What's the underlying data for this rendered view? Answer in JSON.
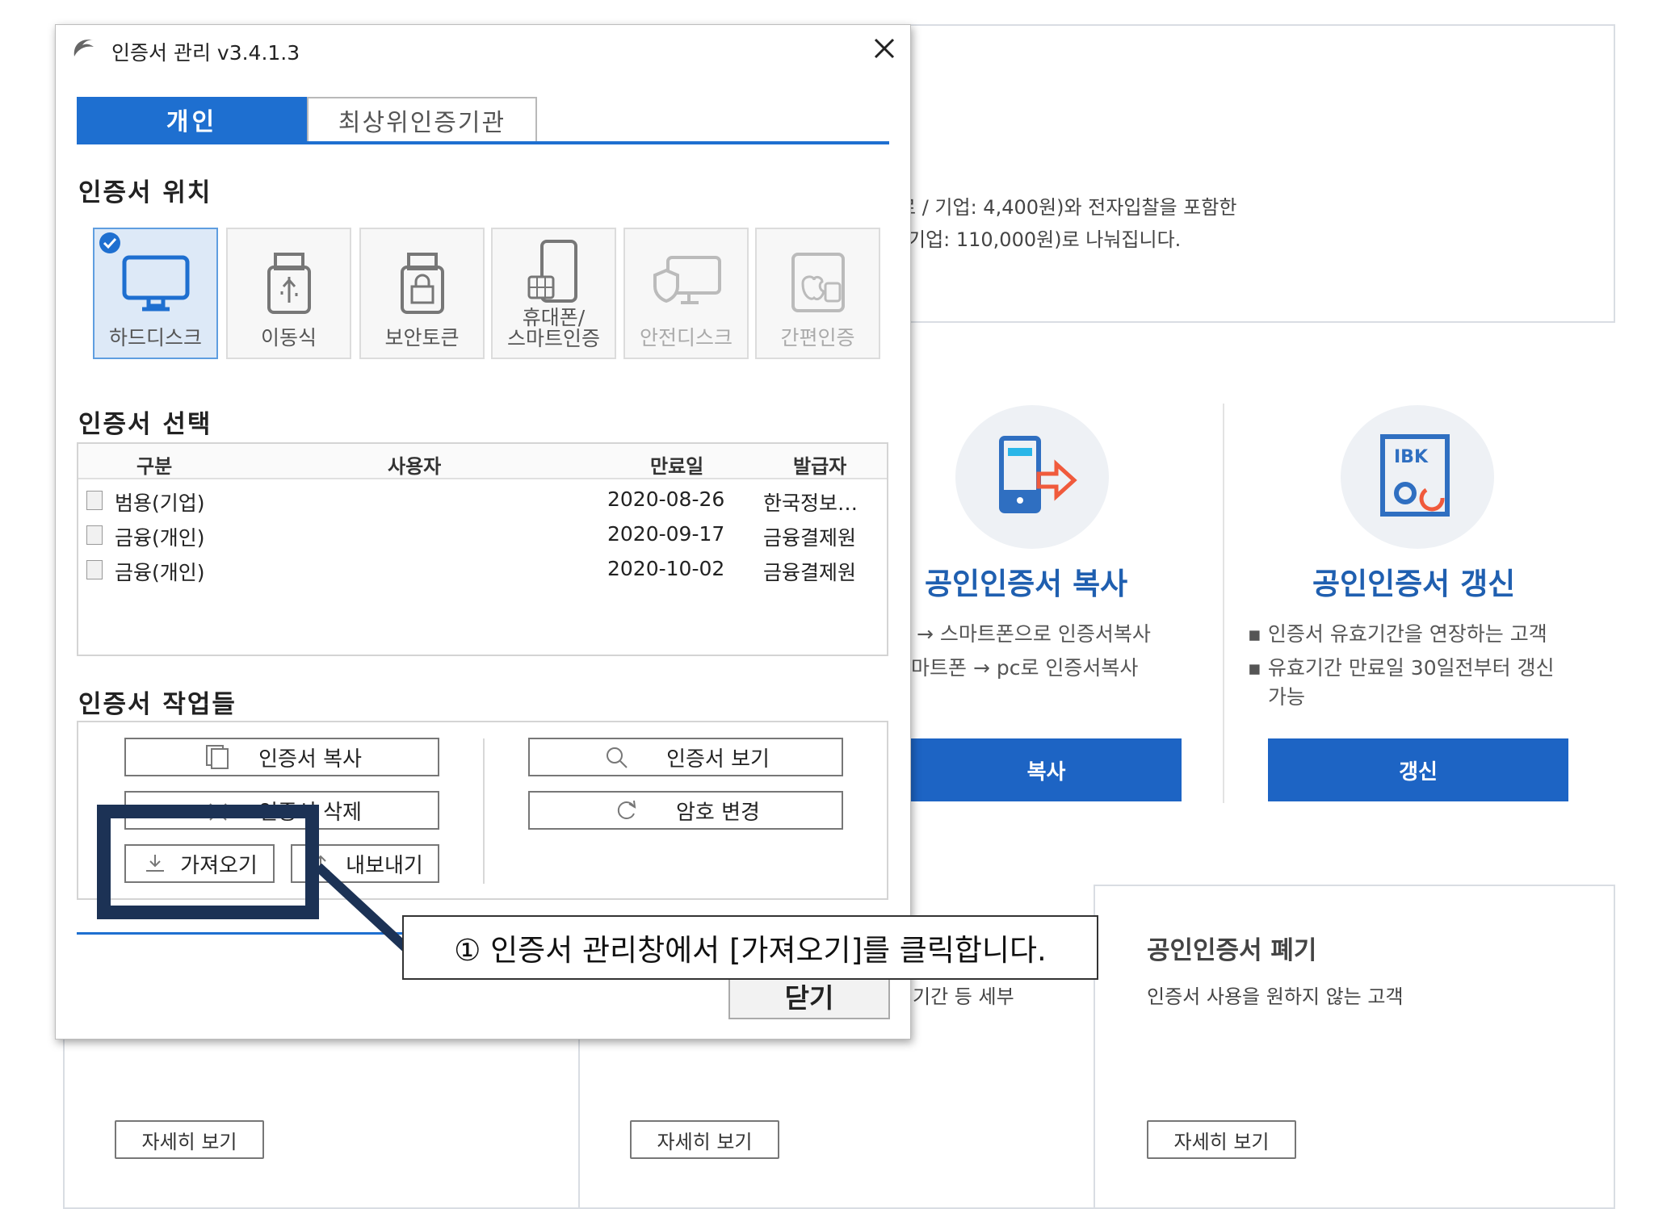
{
  "background": {
    "top_info_lines": [
      "료 / 기업: 4,400원)와 전자입찰을 포함한",
      "기업: 110,000원)로 나눠집니다."
    ],
    "copy_card": {
      "title": "공인인증서 복사",
      "bullets": [
        "→ 스마트폰으로 인증서복사",
        "마트폰 → pc로 인증서복사"
      ],
      "button": "복사",
      "icon": "phone-transfer-icon"
    },
    "renew_card": {
      "title": "공인인증서 갱신",
      "bullets": [
        "▪ 인증서 유효기간을 연장하는 고객",
        "▪ 유효기간 만료일 30일전부터 갱신",
        "가능"
      ],
      "button": "갱신",
      "icon": "ibk-renew-icon",
      "icon_text": "IBK"
    },
    "middle_card": {
      "partial_text": "기간 등 세부"
    },
    "dispose_card": {
      "title": "공인인증서 폐기",
      "description": "인증서 사용을 원하지 않는 고객"
    },
    "detail_buttons": [
      "자세히 보기",
      "자세히 보기",
      "자세히 보기"
    ]
  },
  "dialog": {
    "title": "인증서 관리 v3.4.1.3",
    "tabs": [
      "개인",
      "최상위인증기관"
    ],
    "location_section": "인증서 위치",
    "locations": [
      {
        "label": "하드디스크",
        "icon": "monitor-icon",
        "selected": true,
        "enabled": true
      },
      {
        "label": "이동식",
        "icon": "usb-icon",
        "selected": false,
        "enabled": true
      },
      {
        "label": "보안토큰",
        "icon": "lock-token-icon",
        "selected": false,
        "enabled": true
      },
      {
        "label": "휴대폰/\n스마트인증",
        "icon": "phone-sim-icon",
        "selected": false,
        "enabled": true
      },
      {
        "label": "안전디스크",
        "icon": "shield-monitor-icon",
        "selected": false,
        "enabled": false
      },
      {
        "label": "간편인증",
        "icon": "apple-android-icon",
        "selected": false,
        "enabled": false
      }
    ],
    "select_section": "인증서 선택",
    "table": {
      "headers": [
        "구분",
        "사용자",
        "만료일",
        "발급자"
      ],
      "rows": [
        {
          "type": "범용(기업)",
          "user": "",
          "expiry": "2020-08-26",
          "issuer": "한국정보…"
        },
        {
          "type": "금융(개인)",
          "user": "",
          "expiry": "2020-09-17",
          "issuer": "금융결제원"
        },
        {
          "type": "금융(개인)",
          "user": "",
          "expiry": "2020-10-02",
          "issuer": "금융결제원"
        }
      ]
    },
    "ops_section": "인증서 작업들",
    "ops": {
      "copy": "인증서 복사",
      "delete": "인증서 삭제",
      "import": "가져오기",
      "export": "내보내기",
      "view": "인증서 보기",
      "change_password": "암호 변경"
    },
    "close_label": "닫기"
  },
  "annotation": {
    "callout": "① 인증서 관리창에서 [가져오기]를 클릭합니다."
  },
  "colors": {
    "accent": "#1e6fd0",
    "highlight_frame": "#1c3255",
    "card_title": "#1f5fb0"
  }
}
